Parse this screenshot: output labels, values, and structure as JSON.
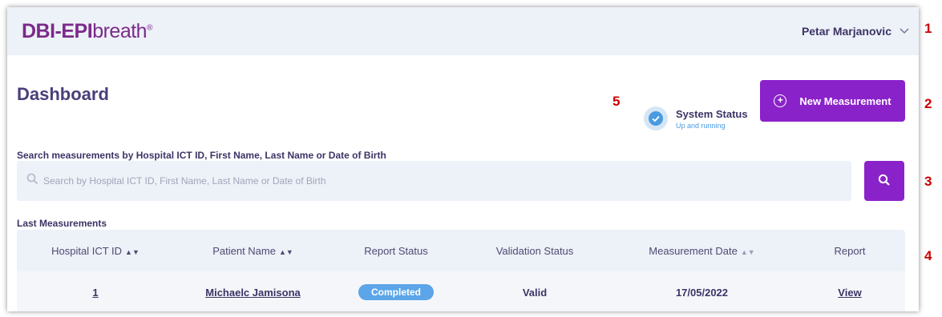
{
  "header": {
    "logo_bold": "DBI-EPI",
    "logo_rest": "breath",
    "logo_mark": "®",
    "user_name": "Petar Marjanovic",
    "user_icon": "chevron-down-icon"
  },
  "page": {
    "title": "Dashboard"
  },
  "system_status": {
    "title": "System Status",
    "subtitle": "Up and running",
    "icon": "check-circle-icon"
  },
  "actions": {
    "new_measurement_label": "New Measurement",
    "new_measurement_icon": "plus-circle-icon"
  },
  "search": {
    "label": "Search measurements by Hospital ICT ID, First Name, Last Name or Date of Birth",
    "placeholder": "Search by Hospital ICT ID, First Name, Last Name or Date of Birth",
    "value": "",
    "button_icon": "search-icon"
  },
  "measurements": {
    "section_title": "Last Measurements",
    "columns": [
      "Hospital ICT ID",
      "Patient Name",
      "Report Status",
      "Validation Status",
      "Measurement Date",
      "Report"
    ],
    "rows": [
      {
        "hospital_ict_id": "1",
        "patient_name": "Michaelc Jamisona",
        "report_status": "Completed",
        "validation_status": "Valid",
        "measurement_date": "17/05/2022",
        "report": "View"
      }
    ]
  },
  "annotations": [
    "1",
    "2",
    "3",
    "4",
    "5"
  ],
  "colors": {
    "brand": "#7b2a8a",
    "primary_button": "#8a22c9",
    "header_bg": "#edf1f8",
    "status_blue": "#4a9be0",
    "badge_blue": "#5ba5e8",
    "annotation_red": "#cc0000"
  }
}
